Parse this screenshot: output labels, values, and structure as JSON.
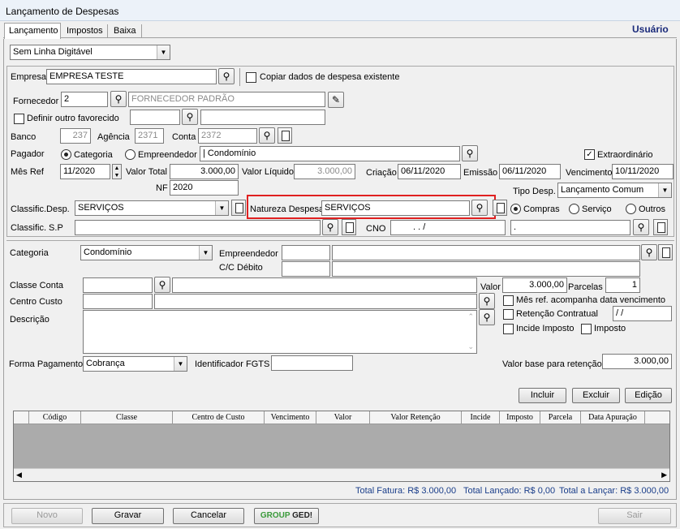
{
  "window": {
    "title": "Lançamento de Despesas",
    "user_label": "Usuário"
  },
  "tabs": [
    "Lançamento",
    "Impostos",
    "Baixa"
  ],
  "top_select": "Sem Linha Digitável",
  "empresa": {
    "label": "Empresa",
    "value": "EMPRESA TESTE",
    "copy_label": "Copiar dados de despesa existente"
  },
  "fornecedor": {
    "label": "Fornecedor",
    "code": "2",
    "name": "FORNECEDOR PADRÃO"
  },
  "favorecido": {
    "label": "Definir outro favorecido"
  },
  "banco": {
    "label": "Banco",
    "value": "237",
    "agencia_label": "Agência",
    "agencia": "2371",
    "conta_label": "Conta",
    "conta": "2372"
  },
  "pagador": {
    "label": "Pagador",
    "opt1": "Categoria",
    "opt2": "Empreendedor",
    "value": "| Condomínio",
    "extra_label": "Extraordinário"
  },
  "mes_ref": {
    "label": "Mês Ref",
    "value": "11/2020"
  },
  "valor_total": {
    "label": "Valor Total",
    "value": "3.000,00"
  },
  "valor_liquido": {
    "label": "Valor Líquido",
    "value": "3.000,00"
  },
  "criacao": {
    "label": "Criação",
    "value": "06/11/2020"
  },
  "emissao": {
    "label": "Emissão",
    "value": "06/11/2020"
  },
  "vencimento": {
    "label": "Vencimento",
    "value": "10/11/2020"
  },
  "nf": {
    "label": "NF",
    "value": "2020"
  },
  "tipo_desp": {
    "label": "Tipo Desp.",
    "value": "Lançamento Comum"
  },
  "classif_desp": {
    "label": "Classific.Desp.",
    "value": "SERVIÇOS"
  },
  "natureza": {
    "label": "Natureza Despesa",
    "value": "SERVIÇOS"
  },
  "natureza_opts": [
    "Compras",
    "Serviço",
    "Outros"
  ],
  "classif_sp": {
    "label": "Classific. S.P"
  },
  "cno": {
    "label": "CNO",
    "mask": ". .   /",
    "dot": "."
  },
  "categoria": {
    "label": "Categoria",
    "value": "Condomínio"
  },
  "empreendedor": {
    "label": "Empreendedor"
  },
  "cc_debito": {
    "label": "C/C Débito"
  },
  "classe_conta": {
    "label": "Classe Conta"
  },
  "valor": {
    "label": "Valor",
    "value": "3.000,00",
    "parcelas_label": "Parcelas",
    "parcelas": "1"
  },
  "centro_custo": {
    "label": "Centro Custo"
  },
  "mes_ref_acomp": "Mês ref. acompanha data vencimento",
  "retencao": {
    "label": "Retenção Contratual",
    "date": "  /  /"
  },
  "incide_imposto": "Incide Imposto",
  "imposto": "Imposto",
  "descricao": {
    "label": "Descrição"
  },
  "forma_pagamento": {
    "label": "Forma Pagamento",
    "value": "Cobrança"
  },
  "fgts": {
    "label": "Identificador FGTS"
  },
  "valor_base": {
    "label": "Valor base para retenção",
    "value": "3.000,00"
  },
  "grid_buttons": [
    "Incluir",
    "Excluir",
    "Edição"
  ],
  "grid_columns": [
    "Código",
    "Classe",
    "Centro de Custo",
    "Vencimento",
    "Valor",
    "Valor Retenção",
    "Incide",
    "Imposto",
    "Parcela",
    "Data Apuração"
  ],
  "totals": {
    "fatura": "Total Fatura: R$ 3.000,00",
    "lancado": "Total Lançado: R$ 0,00",
    "a_lancar": "Total a Lançar: R$ 3.000,00"
  },
  "footer": {
    "novo": "Novo",
    "gravar": "Gravar",
    "cancelar": "Cancelar",
    "ged_group": "GROUP",
    "ged": "GED!",
    "sair": "Sair"
  },
  "colors": {
    "highlight": "#e02020",
    "totals_text": "#1a3e8a",
    "user_label": "#1a2a7a"
  }
}
